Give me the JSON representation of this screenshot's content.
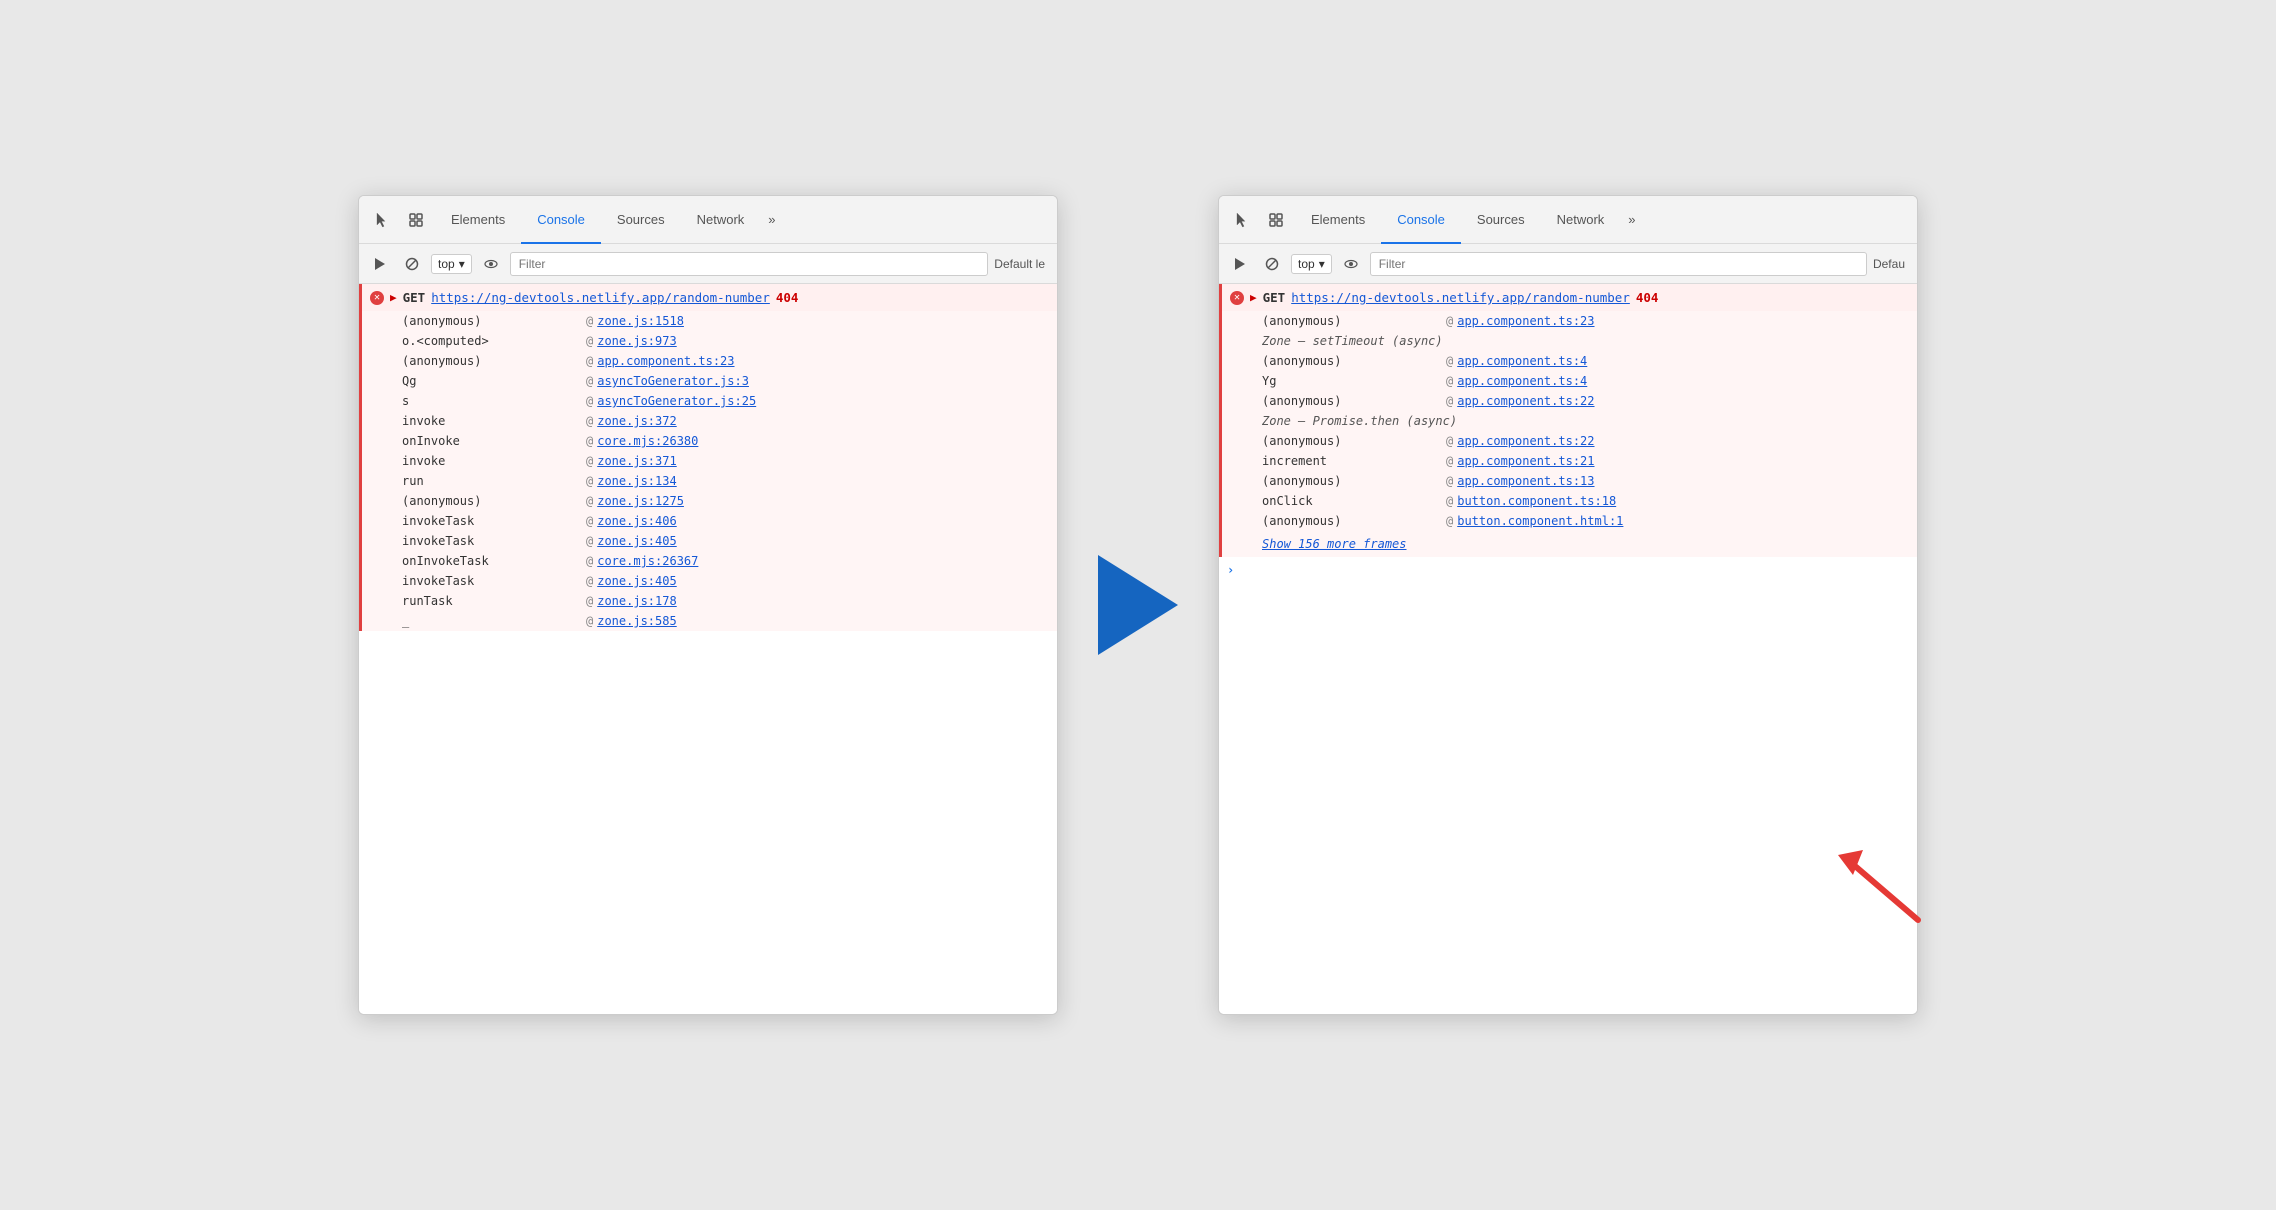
{
  "left_panel": {
    "tabs": [
      {
        "label": "Elements",
        "active": false
      },
      {
        "label": "Console",
        "active": true
      },
      {
        "label": "Sources",
        "active": false
      },
      {
        "label": "Network",
        "active": false
      },
      {
        "label": "»",
        "active": false
      }
    ],
    "toolbar": {
      "top_label": "top",
      "filter_placeholder": "Filter",
      "default_label": "Default le"
    },
    "error": {
      "method": "GET",
      "url": "https://ng-devtools.netlify.app/random-number",
      "status": "404"
    },
    "stack_frames": [
      {
        "fn": "(anonymous)",
        "at": "@",
        "link": "zone.js:1518"
      },
      {
        "fn": "o.<computed>",
        "at": "@",
        "link": "zone.js:973"
      },
      {
        "fn": "(anonymous)",
        "at": "@",
        "link": "app.component.ts:23"
      },
      {
        "fn": "Qg",
        "at": "@",
        "link": "asyncToGenerator.js:3"
      },
      {
        "fn": "s",
        "at": "@",
        "link": "asyncToGenerator.js:25"
      },
      {
        "fn": "invoke",
        "at": "@",
        "link": "zone.js:372"
      },
      {
        "fn": "onInvoke",
        "at": "@",
        "link": "core.mjs:26380"
      },
      {
        "fn": "invoke",
        "at": "@",
        "link": "zone.js:371"
      },
      {
        "fn": "run",
        "at": "@",
        "link": "zone.js:134"
      },
      {
        "fn": "(anonymous)",
        "at": "@",
        "link": "zone.js:1275"
      },
      {
        "fn": "invokeTask",
        "at": "@",
        "link": "zone.js:406"
      },
      {
        "fn": "invokeTask",
        "at": "@",
        "link": "zone.js:405"
      },
      {
        "fn": "onInvokeTask",
        "at": "@",
        "link": "core.mjs:26367"
      },
      {
        "fn": "invokeTask",
        "at": "@",
        "link": "zone.js:405"
      },
      {
        "fn": "runTask",
        "at": "@",
        "link": "zone.js:178"
      },
      {
        "fn": "_",
        "at": "@",
        "link": "zone.js:585"
      }
    ]
  },
  "right_panel": {
    "tabs": [
      {
        "label": "Elements",
        "active": false
      },
      {
        "label": "Console",
        "active": true
      },
      {
        "label": "Sources",
        "active": false
      },
      {
        "label": "Network",
        "active": false
      },
      {
        "label": "»",
        "active": false
      }
    ],
    "toolbar": {
      "top_label": "top",
      "filter_placeholder": "Filter",
      "default_label": "Defau"
    },
    "error": {
      "method": "GET",
      "url": "https://ng-devtools.netlify.app/random-number",
      "status": "404"
    },
    "stack_frames": [
      {
        "fn": "(anonymous)",
        "at": "@",
        "link": "app.component.ts:23",
        "async": false
      },
      {
        "fn": "Zone – setTimeout (async)",
        "at": "",
        "link": "",
        "async": true
      },
      {
        "fn": "(anonymous)",
        "at": "@",
        "link": "app.component.ts:4",
        "async": false
      },
      {
        "fn": "Yg",
        "at": "@",
        "link": "app.component.ts:4",
        "async": false
      },
      {
        "fn": "(anonymous)",
        "at": "@",
        "link": "app.component.ts:22",
        "async": false
      },
      {
        "fn": "Zone – Promise.then (async)",
        "at": "",
        "link": "",
        "async": true
      },
      {
        "fn": "(anonymous)",
        "at": "@",
        "link": "app.component.ts:22",
        "async": false
      },
      {
        "fn": "increment",
        "at": "@",
        "link": "app.component.ts:21",
        "async": false
      },
      {
        "fn": "(anonymous)",
        "at": "@",
        "link": "app.component.ts:13",
        "async": false
      },
      {
        "fn": "onClick",
        "at": "@",
        "link": "button.component.ts:18",
        "async": false
      },
      {
        "fn": "(anonymous)",
        "at": "@",
        "link": "button.component.html:1",
        "async": false
      }
    ],
    "show_more": "Show 156 more frames"
  },
  "icons": {
    "cursor": "⬚",
    "layers": "⧠",
    "play": "▶",
    "ban": "⊘",
    "eye": "◉",
    "chevron_down": "▾"
  }
}
